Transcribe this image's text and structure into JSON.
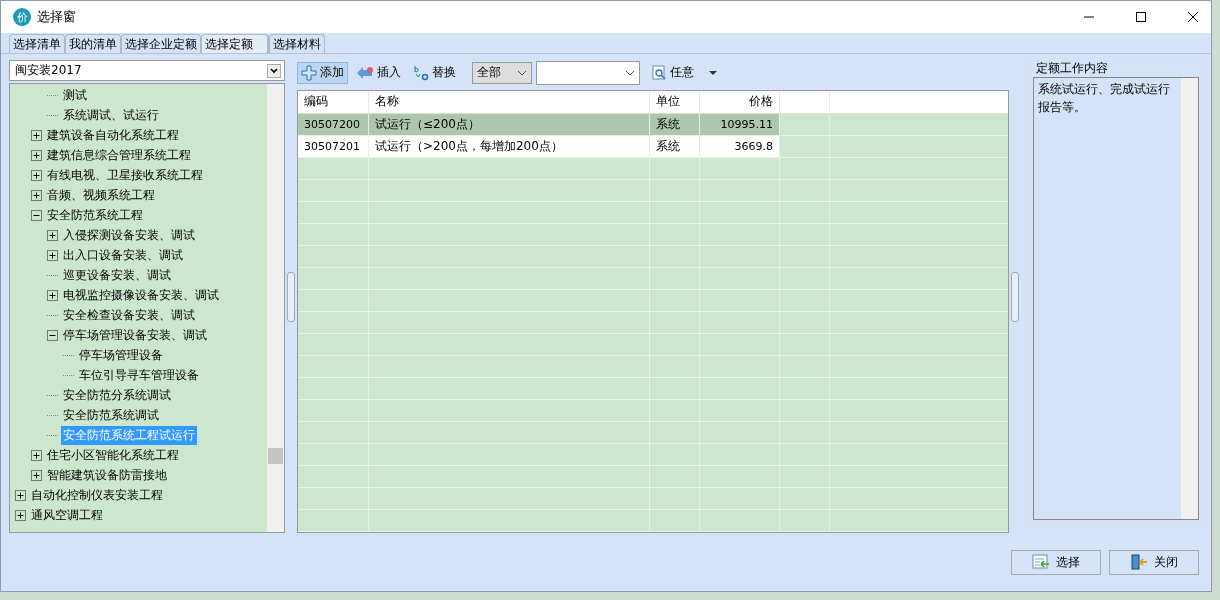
{
  "window": {
    "icon_text": "价",
    "title": "选择窗"
  },
  "tabs": [
    {
      "label": "选择清单",
      "selected": false
    },
    {
      "label": "我的清单",
      "selected": false
    },
    {
      "label": "选择企业定额",
      "selected": false
    },
    {
      "label": "选择定额",
      "selected": true
    },
    {
      "label": "选择材料",
      "selected": false
    }
  ],
  "library_select": {
    "value": "闽安装2017"
  },
  "tree": {
    "items": [
      {
        "children": [
          {
            "children": [
              {
                "label": "测试",
                "selected": false
              },
              {
                "label": "系统调试、试运行",
                "selected": false
              }
            ]
          },
          {
            "label": "建筑设备自动化系统工程",
            "selected": false,
            "expanded": false
          },
          {
            "label": "建筑信息综合管理系统工程",
            "selected": false,
            "expanded": false
          },
          {
            "label": "有线电视、卫星接收系统工程",
            "selected": false,
            "expanded": false
          },
          {
            "label": "音频、视频系统工程",
            "selected": false,
            "expanded": false
          },
          {
            "label": "安全防范系统工程",
            "selected": false,
            "expanded": true,
            "children": [
              {
                "label": "入侵探测设备安装、调试",
                "selected": false,
                "expanded": false
              },
              {
                "label": "出入口设备安装、调试",
                "selected": false,
                "expanded": false
              },
              {
                "label": "巡更设备安装、调试",
                "selected": false
              },
              {
                "label": "电视监控摄像设备安装、调试",
                "selected": false,
                "expanded": false
              },
              {
                "label": "安全检查设备安装、调试",
                "selected": false
              },
              {
                "label": "停车场管理设备安装、调试",
                "selected": false,
                "expanded": true,
                "children": [
                  {
                    "label": "停车场管理设备",
                    "selected": false
                  },
                  {
                    "label": "车位引导寻车管理设备",
                    "selected": false
                  }
                ]
              },
              {
                "label": "安全防范分系统调试",
                "selected": false
              },
              {
                "label": "安全防范系统调试",
                "selected": false
              },
              {
                "label": "安全防范系统工程试运行",
                "selected": true
              }
            ]
          },
          {
            "label": "住宅小区智能化系统工程",
            "selected": false,
            "expanded": false
          },
          {
            "label": "智能建筑设备防雷接地",
            "selected": false,
            "expanded": false
          }
        ]
      },
      {
        "label": "自动化控制仪表安装工程",
        "selected": false,
        "expanded": false
      },
      {
        "label": "通风空调工程",
        "selected": false,
        "expanded": false
      }
    ]
  },
  "toolbar": {
    "add": "添加",
    "insert": "插入",
    "replace": "替换",
    "scope_select": "全部",
    "search_mode": "任意"
  },
  "table": {
    "columns": [
      "编码",
      "名称",
      "单位",
      "价格"
    ],
    "rows": [
      {
        "code": "30507200",
        "name": "试运行（≤200点）",
        "unit": "系统",
        "price": "10995.11",
        "selected": true
      },
      {
        "code": "30507201",
        "name": "试运行（>200点，每增加200点）",
        "unit": "系统",
        "price": "3669.8",
        "selected": false
      }
    ]
  },
  "work_content": {
    "title": "定额工作内容",
    "text": "系统试运行、完成试运行报告等。"
  },
  "buttons": {
    "select": "选择",
    "close": "关闭"
  }
}
